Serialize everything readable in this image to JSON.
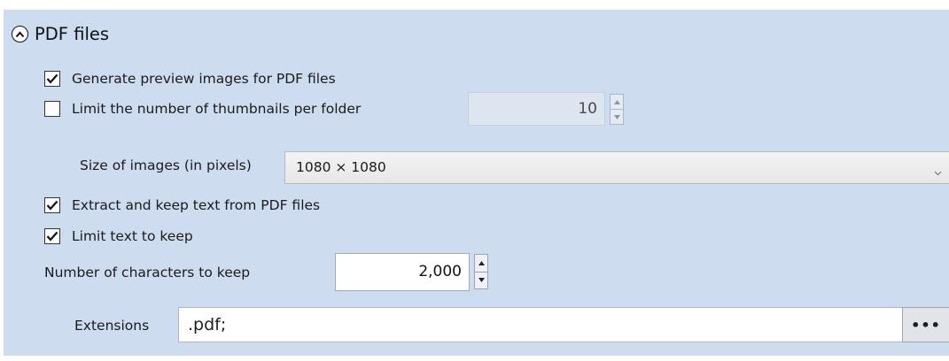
{
  "section": {
    "title": "PDF files",
    "toggle_icon": "chevron-up-icon"
  },
  "options": {
    "generate_preview": {
      "label": "Generate preview images for PDF files",
      "checked": true
    },
    "limit_thumbnails": {
      "label": "Limit the number of thumbnails per folder",
      "checked": false,
      "value": "10",
      "enabled": false
    },
    "image_size": {
      "label": "Size of images (in pixels)",
      "selected": "1080 × 1080"
    },
    "extract_text": {
      "label": "Extract and keep text from PDF files",
      "checked": true
    },
    "limit_text": {
      "label": "Limit text to keep",
      "checked": true
    },
    "num_characters": {
      "label": "Number of characters to keep",
      "value": "2,000"
    },
    "extensions": {
      "label": "Extensions",
      "value": ".pdf;",
      "browse_label": "•••"
    }
  },
  "colors": {
    "panel_background": "#cddcee",
    "disabled_field": "#dde6f0"
  }
}
